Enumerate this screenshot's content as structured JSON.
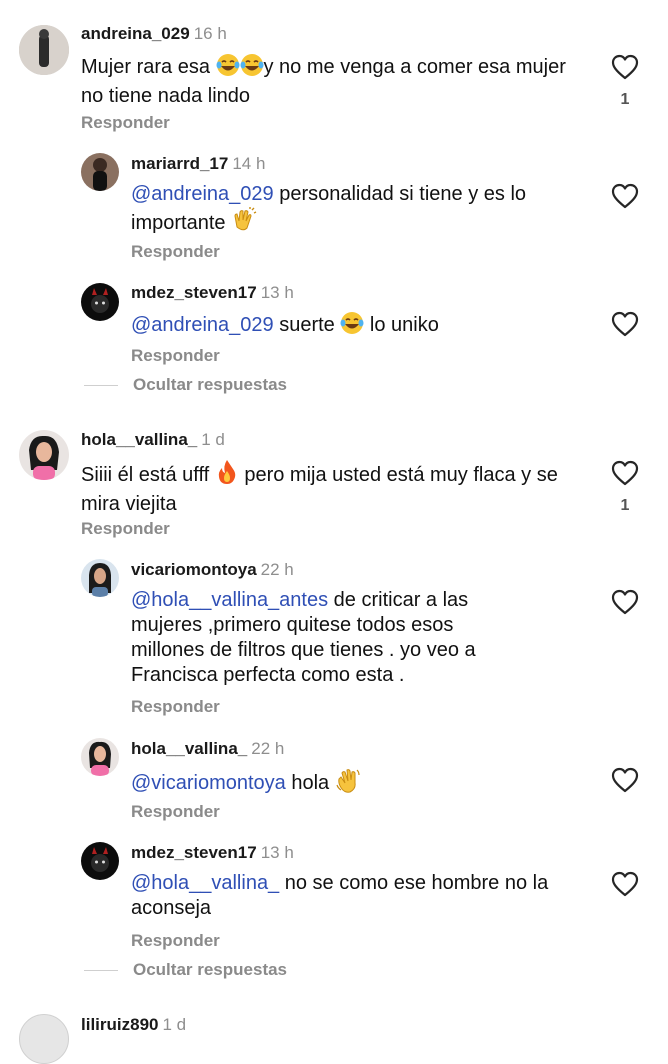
{
  "comments": [
    {
      "username": "andreina_029",
      "time": "16 h",
      "text_a": "Mujer rara esa ",
      "text_b": "y no me venga a comer esa mujer no tiene nada lindo",
      "reply": "Responder",
      "likes": "1",
      "emojis": [
        "laughing-tears-emoji",
        "laughing-tears-emoji"
      ]
    },
    {
      "username": "mariarrd_17",
      "time": "14 h",
      "mention": "@andreina_029",
      "text": " personalidad si tiene y es lo importante ",
      "reply": "Responder",
      "emojis": [
        "clapping-hands-emoji"
      ]
    },
    {
      "username": "mdez_steven17",
      "time": "13 h",
      "mention": "@andreina_029",
      "text_a": " suerte ",
      "text_b": " lo uniko",
      "reply": "Responder",
      "emojis": [
        "laughing-tears-emoji"
      ]
    },
    {
      "username": "hola__vallina_",
      "time": "1 d",
      "text_a": "Siiii él está ufff ",
      "text_b": " pero mija usted está muy flaca y se mira viejita",
      "reply": "Responder",
      "likes": "1",
      "emojis": [
        "fire-emoji"
      ]
    },
    {
      "username": "vicariomontoya",
      "time": "22 h",
      "mention": "@hola__vallina_antes",
      "text": " de criticar a las mujeres ,primero quitese todos esos millones de filtros que tienes . yo veo a Francisca perfecta como esta .",
      "reply": "Responder"
    },
    {
      "username": "hola__vallina_",
      "time": "22 h",
      "mention": "@vicariomontoya",
      "text": " hola ",
      "reply": "Responder",
      "emojis": [
        "waving-hand-emoji"
      ]
    },
    {
      "username": "mdez_steven17",
      "time": "13 h",
      "mention": "@hola__vallina_",
      "text": " no se como ese hombre no la aconseja",
      "reply": "Responder"
    }
  ],
  "hide_replies": "Ocultar respuestas",
  "next_comment": {
    "username": "liliruiz890",
    "time": "1 d"
  },
  "colors": {
    "mention": "#2f4fb5",
    "muted": "#8a8a8a",
    "accent": "#111111"
  }
}
